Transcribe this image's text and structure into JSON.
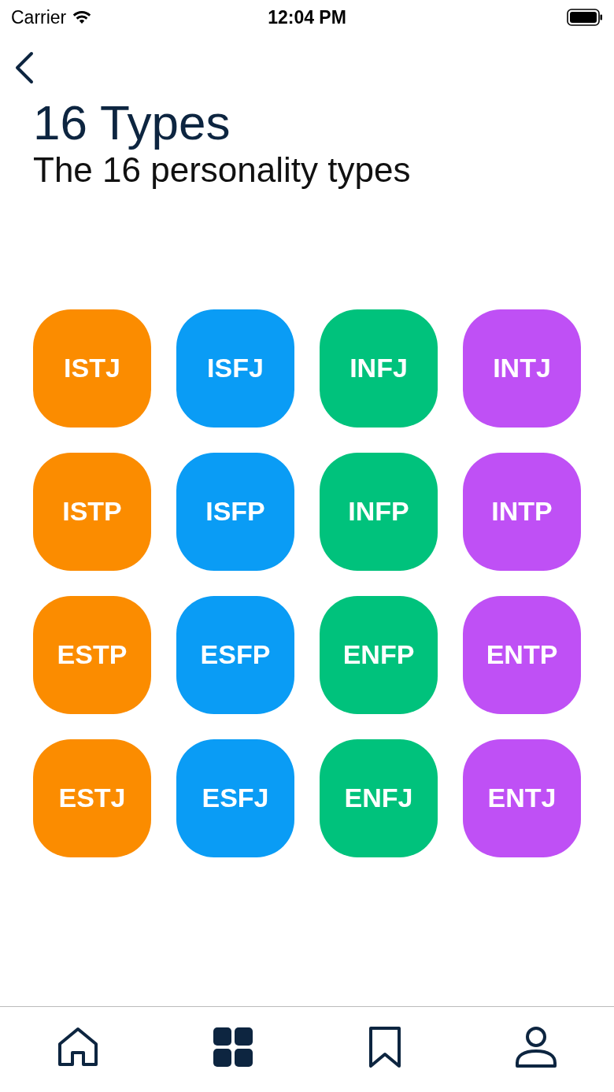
{
  "status_bar": {
    "carrier": "Carrier",
    "time": "12:04 PM"
  },
  "header": {
    "title": "16 Types",
    "subtitle": "The 16 personality types"
  },
  "types": [
    {
      "label": "ISTJ",
      "color": "#fb8c00"
    },
    {
      "label": "ISFJ",
      "color": "#0a9cf5"
    },
    {
      "label": "INFJ",
      "color": "#00c27c"
    },
    {
      "label": "INTJ",
      "color": "#bf50f5"
    },
    {
      "label": "ISTP",
      "color": "#fb8c00"
    },
    {
      "label": "ISFP",
      "color": "#0a9cf5"
    },
    {
      "label": "INFP",
      "color": "#00c27c"
    },
    {
      "label": "INTP",
      "color": "#bf50f5"
    },
    {
      "label": "ESTP",
      "color": "#fb8c00"
    },
    {
      "label": "ESFP",
      "color": "#0a9cf5"
    },
    {
      "label": "ENFP",
      "color": "#00c27c"
    },
    {
      "label": "ENTP",
      "color": "#bf50f5"
    },
    {
      "label": "ESTJ",
      "color": "#fb8c00"
    },
    {
      "label": "ESFJ",
      "color": "#0a9cf5"
    },
    {
      "label": "ENFJ",
      "color": "#00c27c"
    },
    {
      "label": "ENTJ",
      "color": "#bf50f5"
    }
  ],
  "tab_bar": [
    {
      "kind": "home",
      "selected": false
    },
    {
      "kind": "grid",
      "selected": true
    },
    {
      "kind": "bookmark",
      "selected": false
    },
    {
      "kind": "profile",
      "selected": false
    }
  ]
}
